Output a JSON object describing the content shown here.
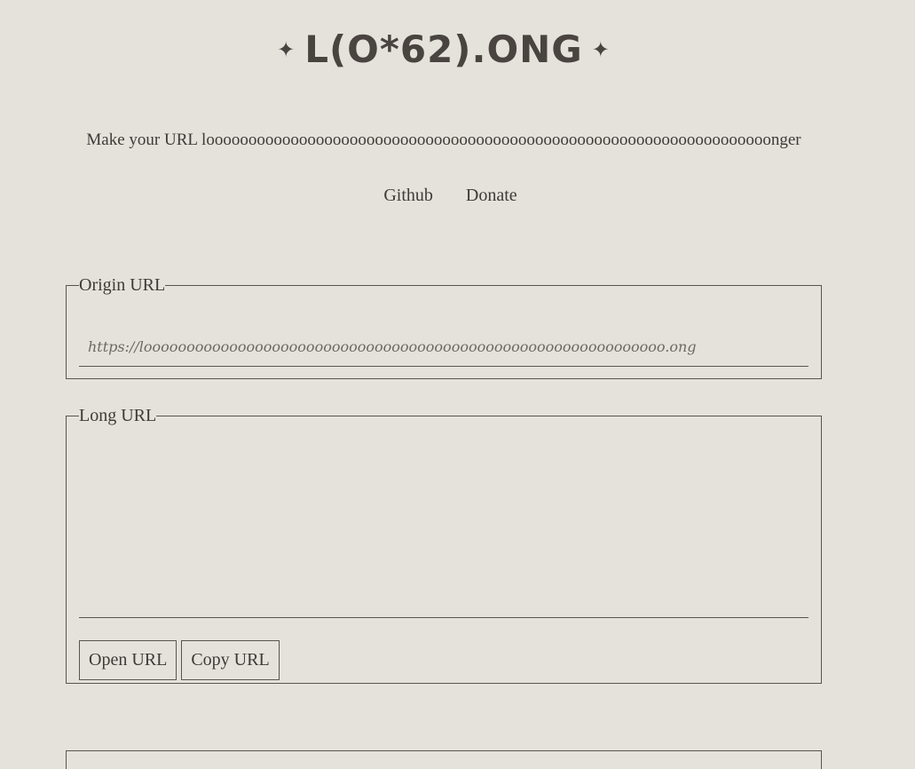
{
  "header": {
    "star_left": "✦",
    "title": "L(O*62).ONG",
    "star_right": "✦"
  },
  "tagline": "Make your URL looooooooooooooooooooooooooooooooooooooooooooooooooooooooooooooooooonger",
  "nav": {
    "github": "Github",
    "donate": "Donate"
  },
  "origin": {
    "legend": "Origin URL",
    "placeholder": "https://looooooooooooooooooooooooooooooooooooooooooooooooooooooooooooo.ong",
    "value": ""
  },
  "long": {
    "legend": "Long URL",
    "value": "",
    "open_label": "Open URL",
    "copy_label": "Copy URL"
  }
}
